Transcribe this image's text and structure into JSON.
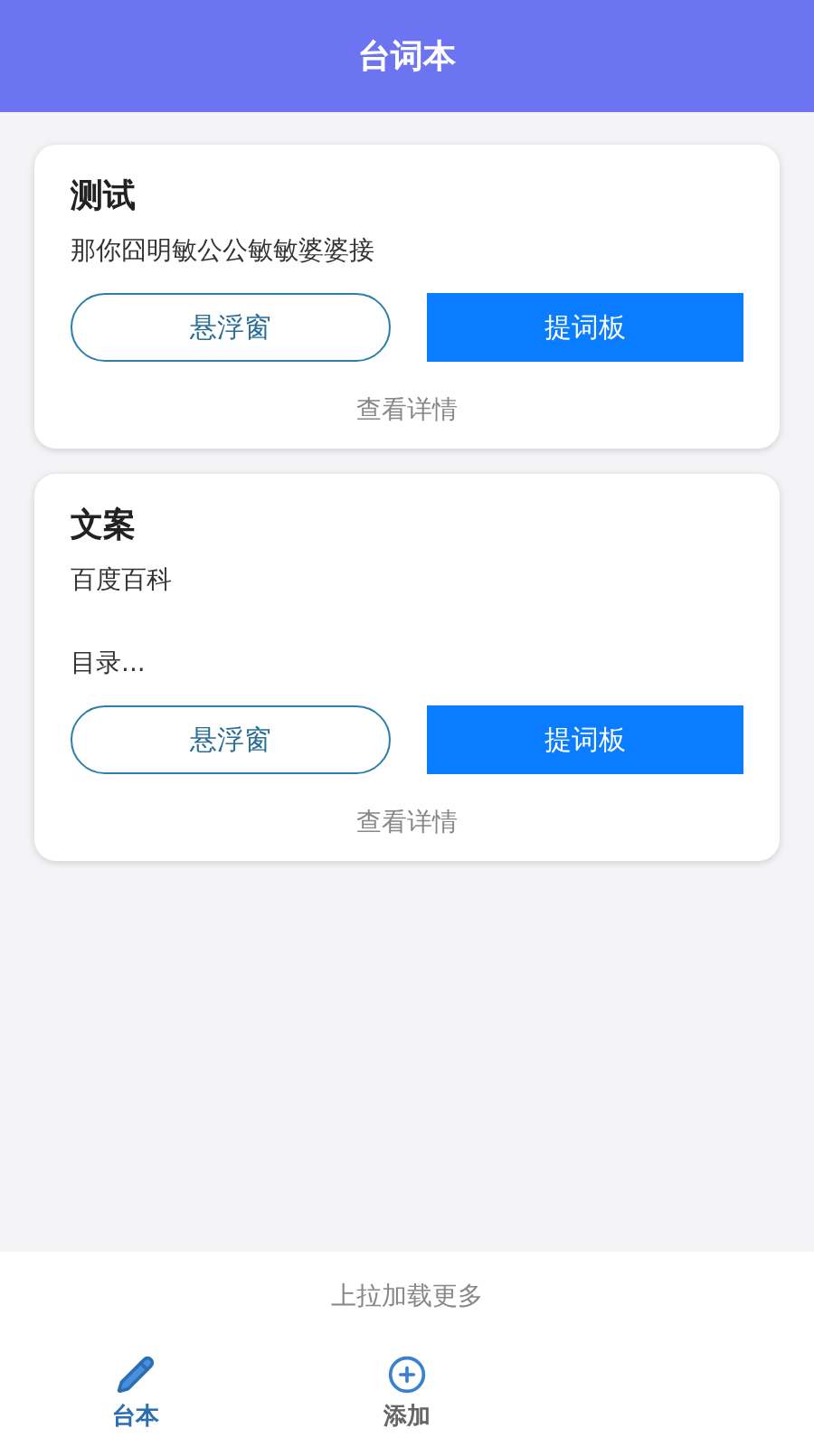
{
  "header": {
    "title": "台词本"
  },
  "cards": [
    {
      "title": "测试",
      "description": "那你囧明敏公公敏敏婆婆接",
      "buttons": [
        {
          "label": "悬浮窗",
          "kind": "outline"
        },
        {
          "label": "提词板",
          "kind": "solid"
        }
      ],
      "detail_link": "查看详情"
    },
    {
      "title": "文案",
      "description": "百度百科",
      "excerpt": "目录...",
      "buttons": [
        {
          "label": "悬浮窗",
          "kind": "outline"
        },
        {
          "label": "提词板",
          "kind": "solid"
        }
      ],
      "detail_link": "查看详情"
    }
  ],
  "load_more": "上拉加载更多",
  "tabs": [
    {
      "label": "台本",
      "kind": "pencil",
      "selected": true
    },
    {
      "label": "添加",
      "kind": "plus",
      "selected": false
    }
  ]
}
